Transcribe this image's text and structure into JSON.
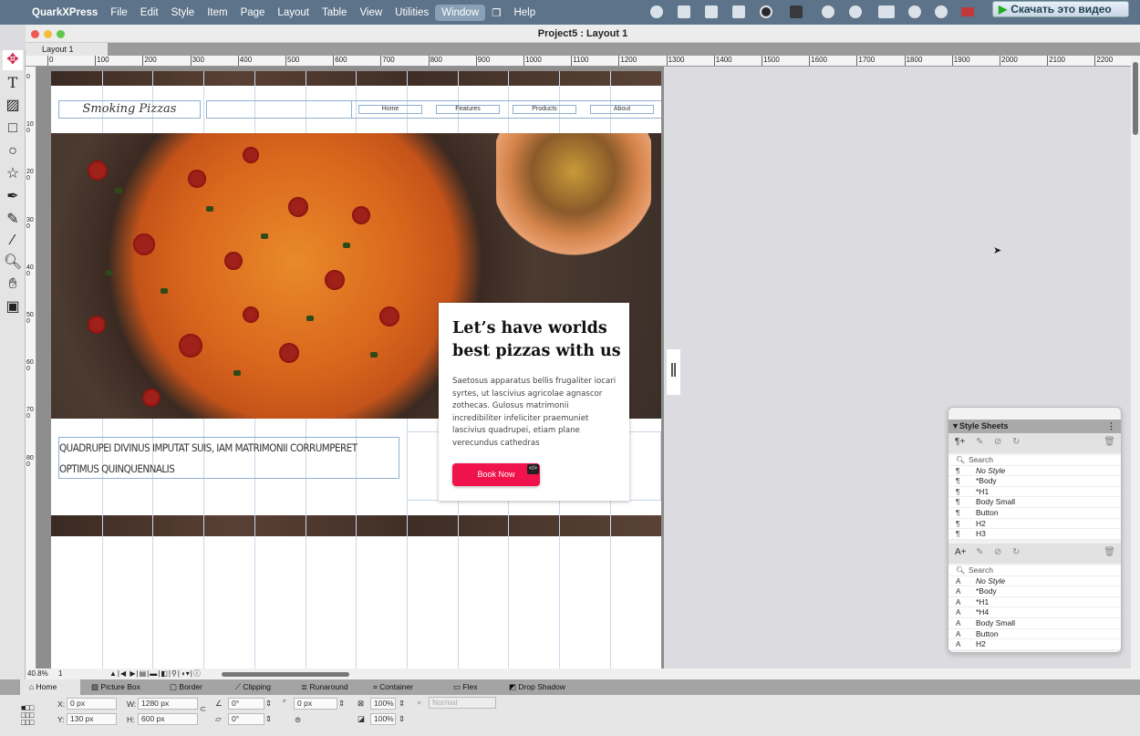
{
  "menubar": {
    "app": "QuarkXPress",
    "items": [
      "File",
      "Edit",
      "Style",
      "Item",
      "Page",
      "Layout",
      "Table",
      "View",
      "Utilities",
      "Window",
      "Help"
    ],
    "active": "Window",
    "download_button": "Скачать это видео"
  },
  "window": {
    "title": "Project5 : Layout 1",
    "tab": "Layout 1"
  },
  "ruler": {
    "h": [
      "0",
      "100",
      "200",
      "300",
      "400",
      "500",
      "600",
      "700",
      "800",
      "900",
      "1000",
      "1100",
      "1200",
      "1300",
      "1400",
      "1500",
      "1600",
      "1700",
      "1800",
      "1900",
      "2000",
      "2100",
      "2200"
    ],
    "v": [
      "0",
      "100",
      "200",
      "300",
      "400",
      "500",
      "600",
      "700",
      "800"
    ]
  },
  "page": {
    "logo": "Smoking Pizzas",
    "nav": [
      "Home",
      "Features",
      "Products",
      "About"
    ],
    "card": {
      "heading": "Let’s have worlds best pizzas with us",
      "body": "Saetosus apparatus bellis frugaliter iocari syrtes, ut lascivius agricolae agnascor zothecas. Gulosus matrimonii incredibiliter infeliciter praemuniet lascivius quadrupei, etiam plane verecundus cathedras",
      "button": "Book Now",
      "badge": "</>"
    },
    "tagline": "QUADRUPEI DIVINUS IMPUTAT SUIS, IAM MATRIMONII CORRUMPERET OPTIMUS QUINQUENNALIS"
  },
  "status": {
    "zoom": "40.8%",
    "page": "1"
  },
  "prop_tabs": [
    "Home",
    "Picture Box",
    "Border",
    "Clipping",
    "Runaround",
    "Container",
    "Flex",
    "Drop Shadow"
  ],
  "props": {
    "x_label": "X:",
    "x": "0 px",
    "y_label": "Y:",
    "y": "130 px",
    "w_label": "W:",
    "w": "1280 px",
    "h_label": "H:",
    "h": "600 px",
    "angle": "0°",
    "skew": "0°",
    "corner": "0 px",
    "opacity1": "100%",
    "opacity2": "100%",
    "blend": "Normal"
  },
  "style_sheets": {
    "title": "Style Sheets",
    "search": "Search",
    "paragraph": [
      "No Style",
      "*Body",
      "*H1",
      "Body Small",
      "Button",
      "H2",
      "H3"
    ],
    "character": [
      "No Style",
      "*Body",
      "*H1",
      "*H4",
      "Body Small",
      "Button",
      "H2"
    ]
  },
  "colors": {
    "accent": "#f0124a",
    "menubar": "#5d7389"
  }
}
